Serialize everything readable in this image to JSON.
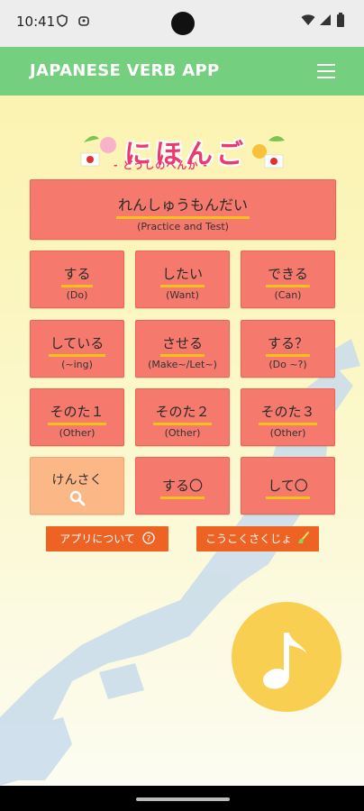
{
  "status": {
    "time": "10:41"
  },
  "appbar": {
    "title": "JAPANESE VERB APP",
    "menu_icon": "hamburger-menu-icon"
  },
  "logo": {
    "title": "にほんご",
    "subtitle": "- どうしのへんか -"
  },
  "practice": {
    "jp": "れんしゅうもんだい",
    "en": "(Practice and Test)"
  },
  "verbs": [
    {
      "jp": "する",
      "en": "(Do)"
    },
    {
      "jp": "したい",
      "en": "(Want)"
    },
    {
      "jp": "できる",
      "en": "(Can)"
    },
    {
      "jp": "している",
      "en": "(~ing)"
    },
    {
      "jp": "させる",
      "en": "(Make~/Let~)"
    },
    {
      "jp": "する？",
      "en": "(Do ~?)"
    },
    {
      "jp": "そのた１",
      "en": "(Other)"
    },
    {
      "jp": "そのた２",
      "en": "(Other)"
    },
    {
      "jp": "そのた３",
      "en": "(Other)"
    }
  ],
  "search": {
    "label": "けんさく"
  },
  "extra": [
    {
      "jp": "する〇"
    },
    {
      "jp": "して〇"
    }
  ],
  "about": {
    "label": "アプリについて"
  },
  "ad_remove": {
    "label": "こうこくさくじょ"
  },
  "colors": {
    "accent": "#74cf7f",
    "button": "#f5796c",
    "underline": "#f2c21b",
    "orange": "#ee6223",
    "fab": "#f9cf52"
  }
}
